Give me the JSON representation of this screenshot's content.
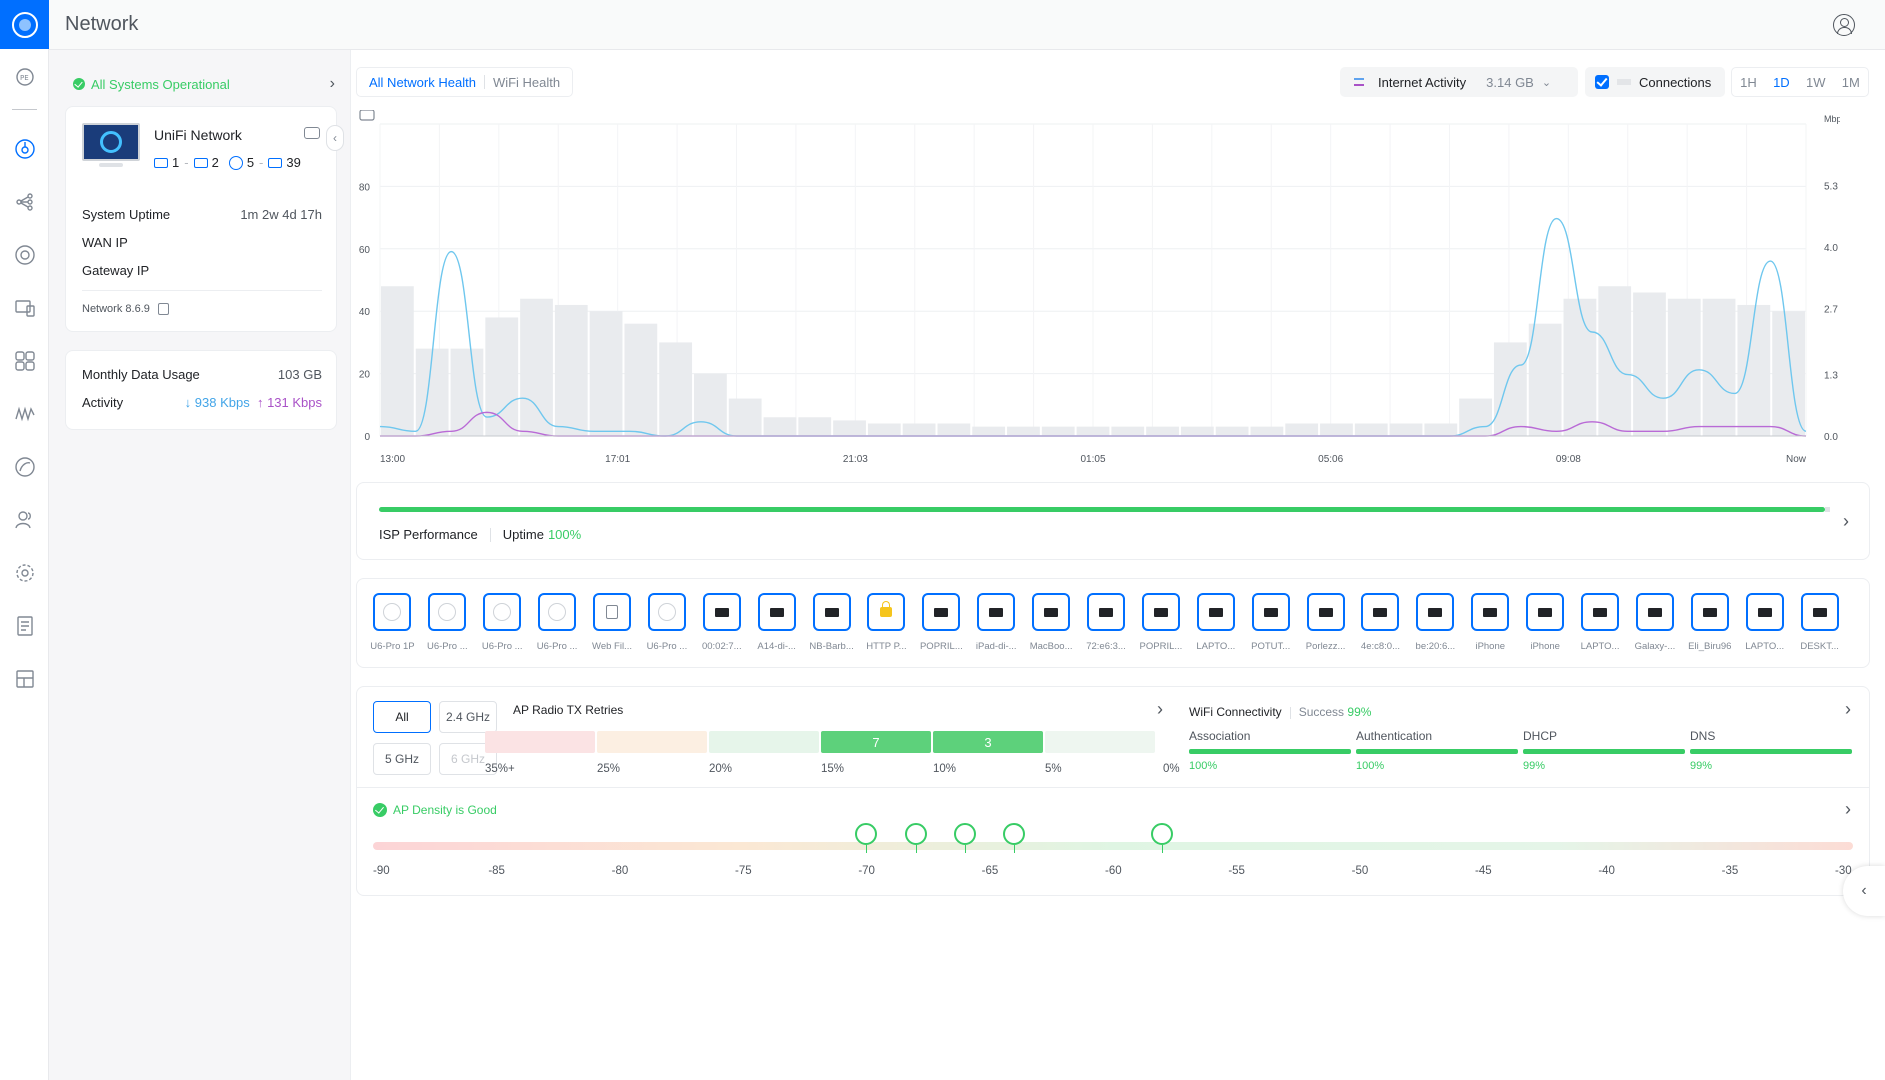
{
  "app": {
    "title": "Network"
  },
  "rail": {
    "items": [
      "PE",
      "dashboard",
      "topology",
      "devices",
      "clients",
      "apps",
      "insights",
      "security",
      "users",
      "settings",
      "logs",
      "reports"
    ]
  },
  "status": {
    "text": "All Systems Operational"
  },
  "device_card": {
    "name": "UniFi Network",
    "counts": {
      "gateways": "1",
      "switches": "2",
      "aps": "5",
      "clients": "39"
    },
    "uptime_label": "System Uptime",
    "uptime_value": "1m 2w 4d 17h",
    "wan_label": "WAN IP",
    "gateway_label": "Gateway IP",
    "version": "Network 8.6.9"
  },
  "usage_card": {
    "monthly_label": "Monthly Data Usage",
    "monthly_value": "103 GB",
    "activity_label": "Activity",
    "down": "938 Kbps",
    "up": "131 Kbps"
  },
  "tabs": [
    "All Network Health",
    "WiFi Health"
  ],
  "controls": {
    "internet_activity_label": "Internet Activity",
    "internet_activity_value": "3.14 GB",
    "connections_label": "Connections",
    "ranges": [
      "1H",
      "1D",
      "1W",
      "1M"
    ],
    "active_range": "1D"
  },
  "chart_data": {
    "type": "line",
    "left_axis": {
      "ticks": [
        "0",
        "20",
        "40",
        "60",
        "80"
      ],
      "ylim": [
        0,
        100
      ]
    },
    "right_axis": {
      "unit": "Mbps",
      "ticks": [
        "0.0",
        "1.3",
        "2.7",
        "4.0",
        "5.3"
      ]
    },
    "x_ticks": [
      "13:00",
      "17:01",
      "21:03",
      "01:05",
      "05:06",
      "09:08",
      "Now"
    ],
    "connections": [
      48,
      28,
      28,
      38,
      44,
      42,
      40,
      36,
      30,
      20,
      12,
      6,
      6,
      5,
      4,
      4,
      4,
      3,
      3,
      3,
      3,
      3,
      3,
      3,
      3,
      3,
      4,
      4,
      4,
      4,
      4,
      12,
      30,
      36,
      44,
      48,
      46,
      44,
      44,
      42,
      40
    ],
    "download_mbps": [
      0.2,
      0.1,
      3.9,
      0.4,
      0.8,
      0.2,
      0.1,
      0.1,
      0,
      0.3,
      0,
      0,
      0,
      0,
      0,
      0,
      0,
      0,
      0,
      0,
      0,
      0,
      0,
      0,
      0,
      0,
      0,
      0,
      0,
      0,
      0,
      0.2,
      1.5,
      4.6,
      2.2,
      1.3,
      0.8,
      1.4,
      0.9,
      3.7,
      0.1
    ],
    "upload_mbps": [
      0,
      0,
      0.1,
      0.5,
      0.1,
      0,
      0,
      0,
      0,
      0,
      0,
      0,
      0,
      0,
      0,
      0,
      0,
      0,
      0,
      0,
      0,
      0,
      0,
      0,
      0,
      0,
      0,
      0,
      0,
      0,
      0,
      0,
      0.2,
      0.1,
      0.3,
      0.1,
      0.1,
      0.2,
      0.2,
      0.2,
      0
    ]
  },
  "isp": {
    "label": "ISP Performance",
    "uptime_label": "Uptime",
    "uptime_value": "100%"
  },
  "devices": [
    {
      "label": "U6-Pro 1P",
      "kind": "ap"
    },
    {
      "label": "U6-Pro ...",
      "kind": "ap"
    },
    {
      "label": "U6-Pro ...",
      "kind": "ap"
    },
    {
      "label": "U6-Pro ...",
      "kind": "ap"
    },
    {
      "label": "Web Fil...",
      "kind": "doc"
    },
    {
      "label": "U6-Pro ...",
      "kind": "ap"
    },
    {
      "label": "00:02:7...",
      "kind": "pc"
    },
    {
      "label": "A14-di-...",
      "kind": "pc"
    },
    {
      "label": "NB-Barb...",
      "kind": "pc"
    },
    {
      "label": "HTTP P...",
      "kind": "lock"
    },
    {
      "label": "POPRIL...",
      "kind": "pc"
    },
    {
      "label": "iPad-di-...",
      "kind": "pc"
    },
    {
      "label": "MacBoo...",
      "kind": "pc"
    },
    {
      "label": "72:e6:3...",
      "kind": "pc"
    },
    {
      "label": "POPRIL...",
      "kind": "pc"
    },
    {
      "label": "LAPTO...",
      "kind": "pc"
    },
    {
      "label": "POTUT...",
      "kind": "pc"
    },
    {
      "label": "Porlezz...",
      "kind": "pc"
    },
    {
      "label": "4e:c8:0...",
      "kind": "pc"
    },
    {
      "label": "be:20:6...",
      "kind": "pc"
    },
    {
      "label": "iPhone",
      "kind": "pc"
    },
    {
      "label": "iPhone",
      "kind": "pc"
    },
    {
      "label": "LAPTO...",
      "kind": "pc"
    },
    {
      "label": "Galaxy-...",
      "kind": "pc"
    },
    {
      "label": "Eli_Biru96",
      "kind": "pc"
    },
    {
      "label": "LAPTO...",
      "kind": "pc"
    },
    {
      "label": "DESKT...",
      "kind": "pc"
    }
  ],
  "wifi": {
    "bands": [
      "All",
      "2.4 GHz",
      "5 GHz",
      "6 GHz"
    ],
    "active_band": "All",
    "retries_title": "AP Radio TX Retries",
    "retry_buckets": [
      {
        "label": "35%+",
        "count": "",
        "color": "#fbe3e4"
      },
      {
        "label": "25%",
        "count": "",
        "color": "#fcefe2"
      },
      {
        "label": "20%",
        "count": "",
        "color": "#e6f5ea"
      },
      {
        "label": "15%",
        "count": "7",
        "color": "#5dd17b"
      },
      {
        "label": "10%",
        "count": "3",
        "color": "#5dd17b"
      },
      {
        "label": "5%",
        "count": "",
        "color": "#eef6f0"
      }
    ],
    "retry_end_label": "0%",
    "connectivity_title": "WiFi Connectivity",
    "success_label": "Success",
    "success_value": "99%",
    "stages": [
      {
        "label": "Association",
        "value": "100%"
      },
      {
        "label": "Authentication",
        "value": "100%"
      },
      {
        "label": "DHCP",
        "value": "99%"
      },
      {
        "label": "DNS",
        "value": "99%"
      }
    ],
    "density_text": "AP Density is Good",
    "rssi_ticks": [
      "-90",
      "-85",
      "-80",
      "-75",
      "-70",
      "-65",
      "-60",
      "-55",
      "-50",
      "-45",
      "-40",
      "-35",
      "-30"
    ],
    "ap_rssi": [
      -70,
      -68,
      -66,
      -64,
      -58
    ]
  }
}
